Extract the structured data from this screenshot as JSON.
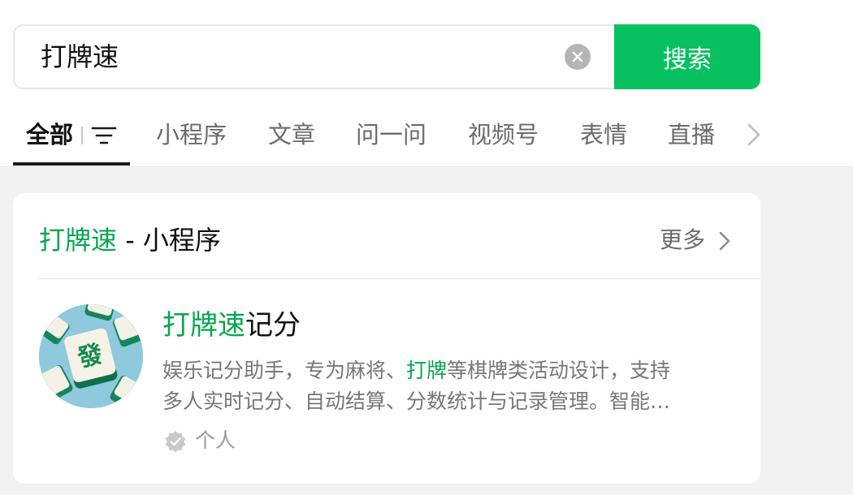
{
  "search": {
    "query": "打牌速",
    "button_label": "搜索"
  },
  "tabs": [
    {
      "label": "全部"
    },
    {
      "label": "小程序"
    },
    {
      "label": "文章"
    },
    {
      "label": "问一问"
    },
    {
      "label": "视频号"
    },
    {
      "label": "表情"
    },
    {
      "label": "直播"
    }
  ],
  "section": {
    "title_highlight": "打牌速",
    "title_rest": " - 小程序",
    "more_label": "更多"
  },
  "result": {
    "name_highlight": "打牌速",
    "name_rest": "记分",
    "desc_line1_a": "娱乐记分助手，专为麻将、",
    "desc_line1_hl": "打牌",
    "desc_line1_b": "等棋牌类活动设计，支持",
    "desc_line2": "多人实时记分、自动结算、分数统计与记录管理。智能…",
    "badge": "个人",
    "avatar_tile_char": "發"
  },
  "colors": {
    "accent": "#07c160",
    "highlight_text": "#07a64f"
  }
}
